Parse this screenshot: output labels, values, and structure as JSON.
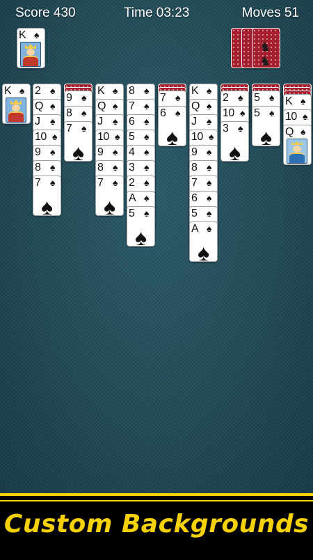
{
  "hud": {
    "score_text": "Score 430",
    "time_text": "Time 03:23",
    "moves_text": "Moves 51"
  },
  "foundation": [
    {
      "rank": "K",
      "suit": "♠",
      "face": "king"
    }
  ],
  "stock": {
    "remaining_deals": 3,
    "deco_icon": "reindeer-icon",
    "deco_glyph": "♞ ♞"
  },
  "tableau": [
    {
      "down": 0,
      "up": [
        {
          "rank": "K",
          "suit": "♠",
          "face": "king"
        }
      ]
    },
    {
      "down": 0,
      "up": [
        {
          "rank": "2",
          "suit": "♠"
        },
        {
          "rank": "Q",
          "suit": "♠"
        },
        {
          "rank": "J",
          "suit": "♠"
        },
        {
          "rank": "10",
          "suit": "♠"
        },
        {
          "rank": "9",
          "suit": "♠"
        },
        {
          "rank": "8",
          "suit": "♠"
        },
        {
          "rank": "7",
          "suit": "♠"
        }
      ]
    },
    {
      "down": 2,
      "up": [
        {
          "rank": "9",
          "suit": "♠"
        },
        {
          "rank": "8",
          "suit": "♠"
        },
        {
          "rank": "7",
          "suit": "♠"
        }
      ]
    },
    {
      "down": 0,
      "up": [
        {
          "rank": "K",
          "suit": "♠"
        },
        {
          "rank": "Q",
          "suit": "♠"
        },
        {
          "rank": "J",
          "suit": "♠"
        },
        {
          "rank": "10",
          "suit": "♠"
        },
        {
          "rank": "9",
          "suit": "♠"
        },
        {
          "rank": "8",
          "suit": "♠"
        },
        {
          "rank": "7",
          "suit": "♠"
        }
      ]
    },
    {
      "down": 0,
      "up": [
        {
          "rank": "8",
          "suit": "♠"
        },
        {
          "rank": "7",
          "suit": "♠"
        },
        {
          "rank": "6",
          "suit": "♠"
        },
        {
          "rank": "5",
          "suit": "♠"
        },
        {
          "rank": "4",
          "suit": "♠"
        },
        {
          "rank": "3",
          "suit": "♠"
        },
        {
          "rank": "2",
          "suit": "♠"
        },
        {
          "rank": "A",
          "suit": "♠"
        },
        {
          "rank": "5",
          "suit": "♠"
        }
      ]
    },
    {
      "down": 2,
      "up": [
        {
          "rank": "7",
          "suit": "♠"
        },
        {
          "rank": "6",
          "suit": "♠"
        }
      ]
    },
    {
      "down": 0,
      "up": [
        {
          "rank": "K",
          "suit": "♠"
        },
        {
          "rank": "Q",
          "suit": "♠"
        },
        {
          "rank": "J",
          "suit": "♠"
        },
        {
          "rank": "10",
          "suit": "♠"
        },
        {
          "rank": "9",
          "suit": "♠"
        },
        {
          "rank": "8",
          "suit": "♠"
        },
        {
          "rank": "7",
          "suit": "♠"
        },
        {
          "rank": "6",
          "suit": "♠"
        },
        {
          "rank": "5",
          "suit": "♠"
        },
        {
          "rank": "A",
          "suit": "♠"
        }
      ]
    },
    {
      "down": 2,
      "up": [
        {
          "rank": "2",
          "suit": "♠"
        },
        {
          "rank": "10",
          "suit": "♠"
        },
        {
          "rank": "3",
          "suit": "♠"
        }
      ]
    },
    {
      "down": 2,
      "up": [
        {
          "rank": "5",
          "suit": "♠"
        },
        {
          "rank": "5",
          "suit": "♠"
        }
      ]
    },
    {
      "down": 3,
      "up": [
        {
          "rank": "K",
          "suit": "♠"
        },
        {
          "rank": "10",
          "suit": "♠"
        },
        {
          "rank": "Q",
          "suit": "♠",
          "face": "queen"
        }
      ]
    }
  ],
  "banner": {
    "text": "Custom Backgrounds"
  },
  "colors": {
    "felt": "#1f4854",
    "card_back": "#a5202f",
    "banner_yellow": "#f7d200"
  }
}
